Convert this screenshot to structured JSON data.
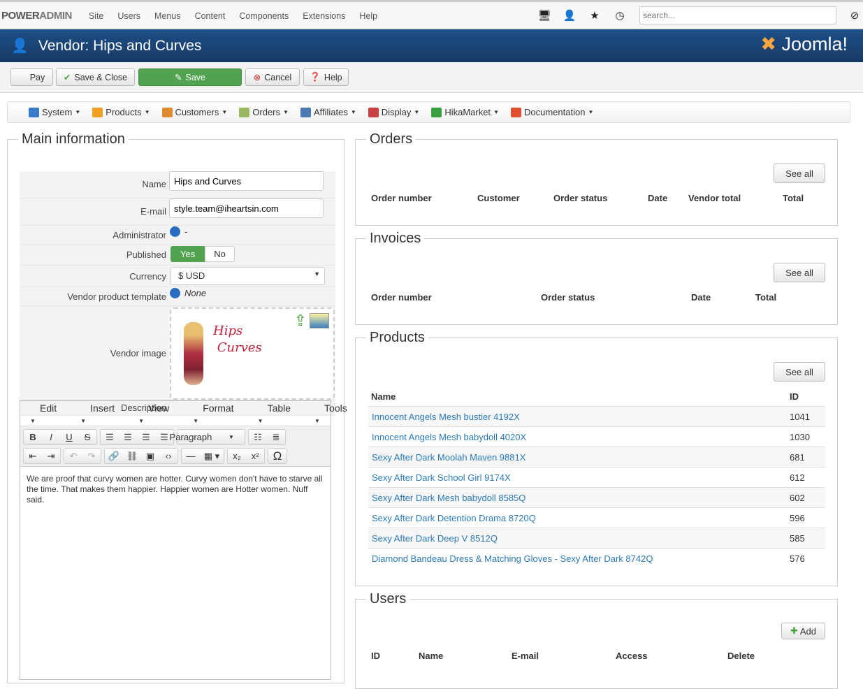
{
  "topbar": {
    "brand_bold": "POWER",
    "brand_rest": "ADMIN",
    "nav": [
      "Site",
      "Users",
      "Menus",
      "Content",
      "Components",
      "Extensions",
      "Help"
    ],
    "search_placeholder": "search..."
  },
  "header": {
    "title": "Vendor: Hips and Curves",
    "logo": "Joomla!"
  },
  "toolbar": {
    "pay": "Pay",
    "save_close": "Save & Close",
    "save": "Save",
    "cancel": "Cancel",
    "help": "Help"
  },
  "menubar": [
    {
      "label": "System",
      "color": "#3a7bc8"
    },
    {
      "label": "Products",
      "color": "#f0a020"
    },
    {
      "label": "Customers",
      "color": "#e08a30"
    },
    {
      "label": "Orders",
      "color": "#9ab860"
    },
    {
      "label": "Affiliates",
      "color": "#4a7ab0"
    },
    {
      "label": "Display",
      "color": "#c84040"
    },
    {
      "label": "HikaMarket",
      "color": "#3aa040"
    },
    {
      "label": "Documentation",
      "color": "#e05030"
    }
  ],
  "main": {
    "legend": "Main information",
    "name_label": "Name",
    "name_value": "Hips and Curves",
    "email_label": "E-mail",
    "email_value": "style.team@iheartsin.com",
    "admin_label": "Administrator",
    "admin_value": "-",
    "published_label": "Published",
    "yes": "Yes",
    "no": "No",
    "currency_label": "Currency",
    "currency_value": "$ USD",
    "template_label": "Vendor product template",
    "template_value": "None",
    "image_label": "Vendor image",
    "description_label": "Description",
    "image_logo": "Hips Curves"
  },
  "editor": {
    "menu": [
      "Edit",
      "Insert",
      "View",
      "Format",
      "Table",
      "Tools"
    ],
    "format": "Paragraph",
    "text": "We are proof that curvy women are hotter. Curvy women don't have to starve all the time. That makes them happier.  Happier women are Hotter women.  Nuff said."
  },
  "orders": {
    "legend": "Orders",
    "see_all": "See all",
    "cols": [
      "Order number",
      "Customer",
      "Order status",
      "Date",
      "Vendor total",
      "Total"
    ]
  },
  "invoices": {
    "legend": "Invoices",
    "see_all": "See all",
    "cols": [
      "Order number",
      "Order status",
      "Date",
      "Total"
    ]
  },
  "products": {
    "legend": "Products",
    "see_all": "See all",
    "col_name": "Name",
    "col_id": "ID",
    "rows": [
      {
        "name": "Innocent Angels Mesh bustier 4192X",
        "id": "1041"
      },
      {
        "name": "Innocent Angels Mesh babydoll 4020X",
        "id": "1030"
      },
      {
        "name": "Sexy After Dark Moolah Maven 9881X",
        "id": "681"
      },
      {
        "name": "Sexy After Dark School Girl 9174X",
        "id": "612"
      },
      {
        "name": "Sexy After Dark Mesh babydoll 8585Q",
        "id": "602"
      },
      {
        "name": "Sexy After Dark Detention Drama 8720Q",
        "id": "596"
      },
      {
        "name": "Sexy After Dark Deep V 8512Q",
        "id": "585"
      },
      {
        "name": "Diamond Bandeau Dress & Matching Gloves - Sexy After Dark 8742Q",
        "id": "576"
      }
    ]
  },
  "users": {
    "legend": "Users",
    "add": "Add",
    "cols": [
      "ID",
      "Name",
      "E-mail",
      "Access",
      "Delete"
    ]
  }
}
